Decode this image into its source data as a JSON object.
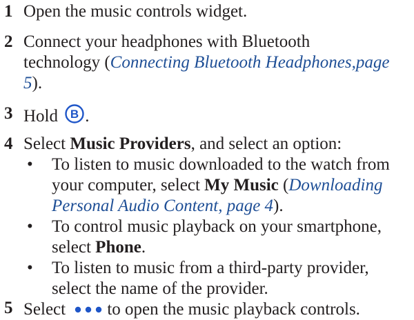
{
  "steps": [
    {
      "number": "1",
      "text": "Open the music controls widget."
    },
    {
      "number": "2",
      "line1": "Connect your headphones with Bluetooth",
      "line2_prefix": "technology (",
      "link_part1": "Connecting Bluetooth Headphones,page",
      "link_part2": "5",
      "suffix": ")."
    },
    {
      "number": "3",
      "text_before": "Hold ",
      "button_letter": "B",
      "text_after": "."
    },
    {
      "number": "4",
      "text_before": "Select ",
      "bold": "Music Providers",
      "text_after": ", and select an option:",
      "bullets": [
        {
          "symbol": "•",
          "line1": "To listen to music downloaded to the watch from",
          "line2_before": "your computer, select ",
          "line2_bold": "My Music",
          "line2_mid": " (",
          "line2_link": "Downloading",
          "line3_link": "Personal Audio Content, page 4",
          "line3_after": ")."
        },
        {
          "symbol": "•",
          "line1": "To control music playback on your smartphone,",
          "line2_before": "select ",
          "line2_bold": "Phone",
          "line2_after": "."
        },
        {
          "symbol": "•",
          "line1": "To listen to music from a third-party provider,",
          "line2": "select the name of the provider."
        }
      ]
    },
    {
      "number": "5",
      "text_before": "Select ",
      "icon": "more-dots-icon",
      "text_after": "to open the music playback controls."
    }
  ],
  "colors": {
    "text": "#231f20",
    "link": "#1f4f96",
    "icon": "#1f56c8"
  }
}
